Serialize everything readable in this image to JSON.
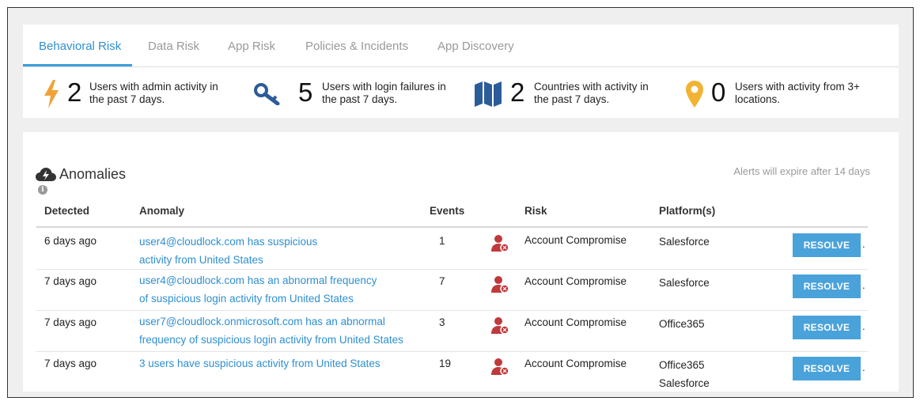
{
  "tabs": [
    {
      "label": "Behavioral Risk",
      "active": true
    },
    {
      "label": "Data Risk",
      "active": false
    },
    {
      "label": "App Risk",
      "active": false
    },
    {
      "label": "Policies & Incidents",
      "active": false
    },
    {
      "label": "App Discovery",
      "active": false
    }
  ],
  "stats": [
    {
      "icon": "bolt-icon",
      "color": "#f0a23a",
      "value": "2",
      "line1": "Users with admin activity in",
      "line2": "the past 7 days."
    },
    {
      "icon": "key-icon",
      "color": "#2b5c9a",
      "value": "5",
      "line1": "Users with login failures in",
      "line2": "the past 7 days."
    },
    {
      "icon": "map-icon",
      "color": "#2b5c9a",
      "value": "2",
      "line1": "Countries with activity in",
      "line2": "the past 7 days."
    },
    {
      "icon": "location-pin-icon",
      "color": "#f2b233",
      "value": "0",
      "line1": "Users with activity from 3+",
      "line2": "locations."
    }
  ],
  "anomalies": {
    "title": "Anomalies",
    "expire_note": "Alerts will expire after 14 days",
    "columns": {
      "detected": "Detected",
      "anomaly": "Anomaly",
      "events": "Events",
      "risk": "Risk",
      "platforms": "Platform(s)"
    },
    "resolve_label": "RESOLVE",
    "rows": [
      {
        "detected": "6 days ago",
        "anomaly_l1": "user4@cloudlock.com has suspicious",
        "anomaly_l2": "activity from United States",
        "events": "1",
        "risk": "Account Compromise",
        "platform_l1": "Salesforce",
        "platform_l2": ""
      },
      {
        "detected": "7 days ago",
        "anomaly_l1": "user4@cloudlock.com has an abnormal frequency",
        "anomaly_l2": "of suspicious login activity from United States",
        "events": "7",
        "risk": "Account Compromise",
        "platform_l1": "Salesforce",
        "platform_l2": ""
      },
      {
        "detected": "7 days ago",
        "anomaly_l1": "user7@cloudlock.onmicrosoft.com has an abnormal",
        "anomaly_l2": "frequency of suspicious login activity from United States",
        "events": "3",
        "risk": "Account Compromise",
        "platform_l1": "Office365",
        "platform_l2": ""
      },
      {
        "detected": "7 days ago",
        "anomaly_l1": "3 users have suspicious activity from United States",
        "anomaly_l2": "",
        "events": "19",
        "risk": "Account Compromise",
        "platform_l1": "Office365",
        "platform_l2": "Salesforce"
      }
    ]
  },
  "colors": {
    "accent": "#2e8fd0",
    "button": "#4aa2db",
    "risk_icon": "#c0393b"
  }
}
